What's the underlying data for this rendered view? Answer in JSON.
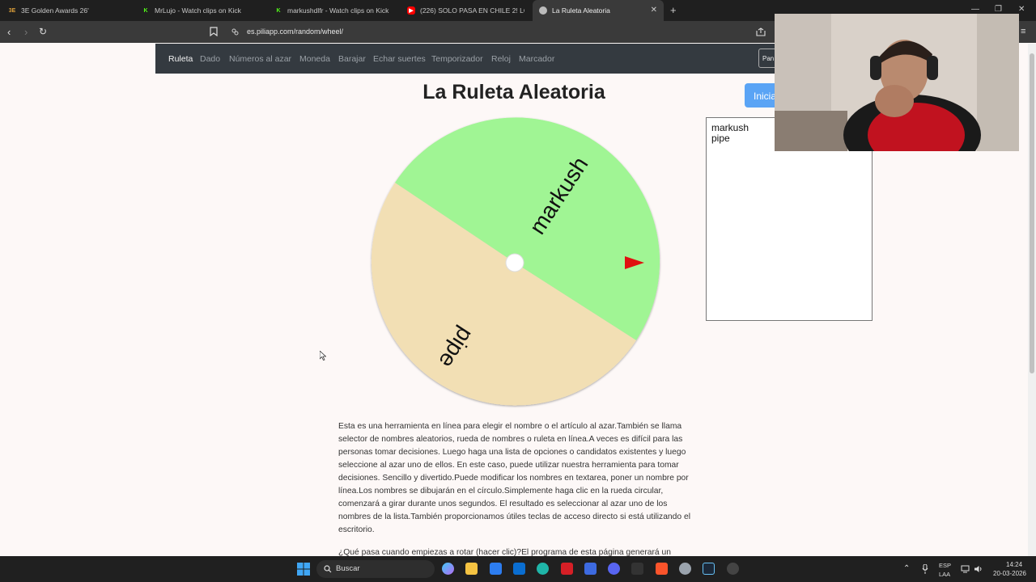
{
  "browser": {
    "tabs": [
      {
        "label": "3E Golden Awards 26'",
        "icon": "3e-logo-icon",
        "color": "#e0a23a"
      },
      {
        "label": "MrLujo - Watch clips on Kick",
        "icon": "kick-icon",
        "color": "#53fc18"
      },
      {
        "label": "markushdlfr - Watch clips on Kick",
        "icon": "kick-icon",
        "color": "#53fc18"
      },
      {
        "label": "(226) SOLO PASA EN CHILE 2! LO ME",
        "icon": "youtube-icon",
        "color": "#ff0000"
      },
      {
        "label": "La Ruleta Aleatoria",
        "icon": "piliapp-icon",
        "color": "#bbbbbb"
      }
    ],
    "new_tab": "+",
    "close": "✕",
    "url": "es.piliapp.com/random/wheel/"
  },
  "site_nav": {
    "items": [
      "Ruleta",
      "Dado",
      "Números al azar",
      "Moneda",
      "Barajar",
      "Echar suertes",
      "Temporizador",
      "Reloj",
      "Marcador"
    ],
    "active": "Ruleta",
    "panel_button": "Pan"
  },
  "page": {
    "title": "La Ruleta Aleatoria",
    "start_button": "Inicia",
    "names_text": "markush\npipe",
    "description": "Esta es una herramienta en línea para elegir el nombre o el artículo al azar.También se llama selector de nombres aleatorios, rueda de nombres o ruleta en línea.A veces es difícil para las personas tomar decisiones. Luego haga una lista de opciones o candidatos existentes y luego seleccione al azar uno de ellos. En este caso, puede utilizar nuestra herramienta para tomar decisiones. Sencillo y divertido.Puede modificar los nombres en textarea, poner un nombre por línea.Los nombres se dibujarán en el círculo.Simplemente haga clic en la rueda circular, comenzará a girar durante unos segundos. El resultado es seleccionar al azar uno de los nombres de la lista.También proporcionamos útiles teclas de acceso directo si está utilizando el escritorio.",
    "description2": "¿Qué pasa cuando empiezas a rotar (hacer clic)?El programa de esta página generará un"
  },
  "wheel": {
    "segments": [
      {
        "label": "markush",
        "color": "#a0f594"
      },
      {
        "label": "pipe",
        "color": "#f2dfb4"
      }
    ],
    "pointer_color": "#e01010"
  },
  "taskbar": {
    "search_label": "Buscar",
    "language": "ESP",
    "layout": "LAA",
    "time": "14:24",
    "date": "20-03-2026"
  }
}
